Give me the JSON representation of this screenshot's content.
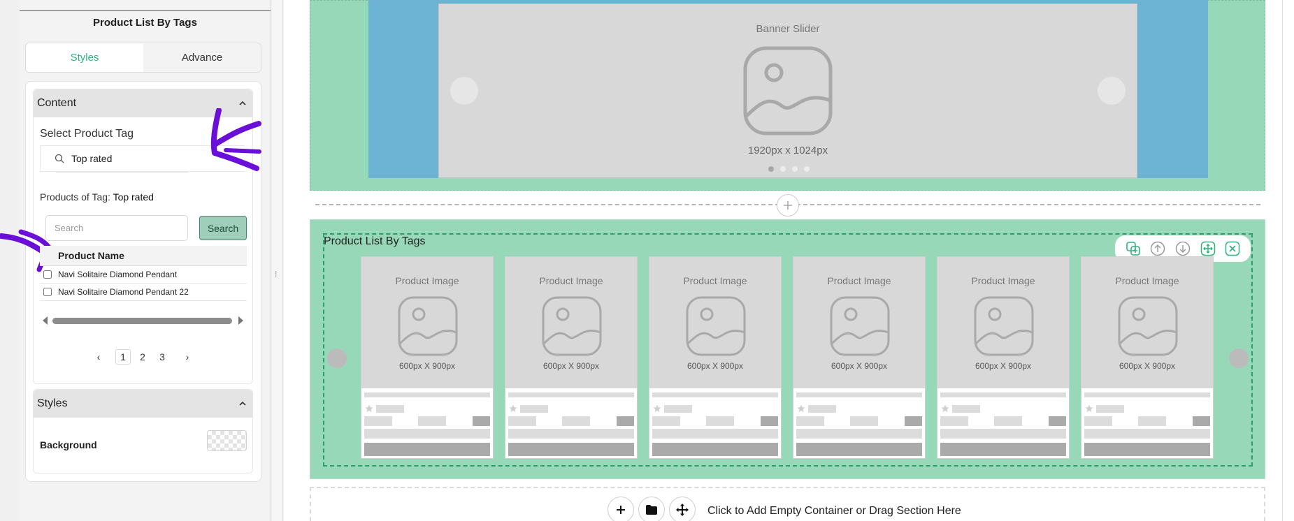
{
  "sidebar": {
    "panel_title": "Product List By Tags",
    "tabs": [
      {
        "label": "Styles",
        "active": true
      },
      {
        "label": "Advance",
        "active": false
      }
    ],
    "content_section": {
      "title": "Content",
      "select_tag_label": "Select Product Tag",
      "tag_value": "Top rated",
      "products_of_tag_prefix": "Products of Tag:",
      "products_of_tag_value": "Top rated",
      "search_placeholder": "Search",
      "search_button": "Search",
      "table": {
        "column": "Product Name",
        "rows": [
          "Navi Solitaire Diamond Pendant",
          "Navi Solitaire Diamond Pendant 22"
        ]
      },
      "pagination": {
        "prev": "‹",
        "pages": [
          "1",
          "2",
          "3"
        ],
        "current": "1",
        "next": "›"
      }
    },
    "styles_section": {
      "title": "Styles",
      "background_label": "Background"
    }
  },
  "canvas": {
    "banner": {
      "title": "Banner Slider",
      "size": "1920px x 1024px",
      "dots": 4,
      "active_dot": 1
    },
    "product_list": {
      "title": "Product List By Tags",
      "cards": [
        {
          "title": "Product Image",
          "size": "600px X 900px"
        },
        {
          "title": "Product Image",
          "size": "600px X 900px"
        },
        {
          "title": "Product Image",
          "size": "600px X 900px"
        },
        {
          "title": "Product Image",
          "size": "600px X 900px"
        },
        {
          "title": "Product Image",
          "size": "600px X 900px"
        },
        {
          "title": "Product Image",
          "size": "600px X 900px"
        }
      ]
    },
    "empty_section_hint": "Click to Add Empty Container or Drag Section Here"
  },
  "colors": {
    "accent": "#2fb27f",
    "section_bg": "#96d8b7",
    "banner_blue": "#6db4d4",
    "annotation_purple": "#6a0fd8"
  },
  "icons": {
    "toolbar": [
      "duplicate-icon",
      "move-up-icon",
      "move-down-icon",
      "drag-move-icon",
      "close-icon"
    ],
    "content_buttons": [
      "plus-icon",
      "folder-icon",
      "drag-move-icon"
    ]
  }
}
